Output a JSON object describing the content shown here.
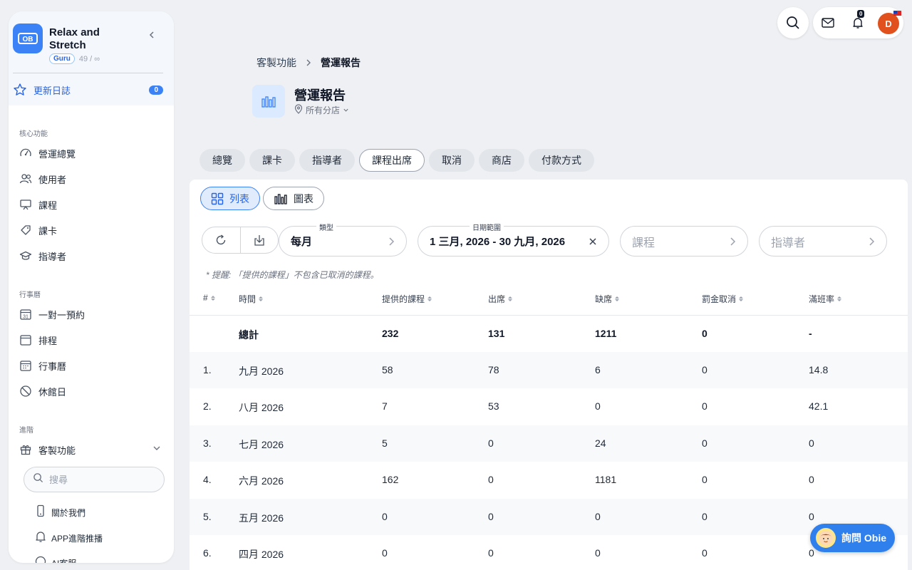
{
  "brand": {
    "name": "Relax and Stretch",
    "tier": "Guru",
    "count": "49 / ∞"
  },
  "changelog": {
    "label": "更新日誌",
    "count": "0"
  },
  "sidebar": {
    "core_label": "核心功能",
    "core": [
      "營運總覽",
      "使用者",
      "課程",
      "課卡",
      "指導者"
    ],
    "calendar_label": "行事曆",
    "calendar": [
      "一對一預約",
      "排程",
      "行事曆",
      "休館日"
    ],
    "advanced_label": "進階",
    "custom": "客製功能",
    "search_placeholder": "搜尋",
    "sub": [
      "關於我們",
      "APP進階推播",
      "AI客服"
    ]
  },
  "topbar": {
    "notifications": "0",
    "avatar_initial": "D"
  },
  "breadcrumb": {
    "parent": "客製功能",
    "current": "營運報告"
  },
  "page": {
    "title": "營運報告",
    "branch": "所有分店"
  },
  "tabs": [
    "總覽",
    "課卡",
    "指導者",
    "課程出席",
    "取消",
    "商店",
    "付款方式"
  ],
  "active_tab": "課程出席",
  "view": {
    "list": "列表",
    "chart": "圖表"
  },
  "filters": {
    "type_caption": "類型",
    "type_value": "每月",
    "date_caption": "日期範圍",
    "date_value": "1 三月, 2026 - 30 九月, 2026",
    "course_placeholder": "課程",
    "instructor_placeholder": "指導者"
  },
  "note": "* 提醒: 「提供的課程」不包含已取消的課程。",
  "table": {
    "headers": [
      "#",
      "時間",
      "提供的課程",
      "出席",
      "缺席",
      "罰金取消",
      "滿班率"
    ],
    "total": [
      "",
      "總計",
      "232",
      "131",
      "1211",
      "0",
      "-"
    ],
    "rows": [
      [
        "1.",
        "九月 2026",
        "58",
        "78",
        "6",
        "0",
        "14.8"
      ],
      [
        "2.",
        "八月 2026",
        "7",
        "53",
        "0",
        "0",
        "42.1"
      ],
      [
        "3.",
        "七月 2026",
        "5",
        "0",
        "24",
        "0",
        "0"
      ],
      [
        "4.",
        "六月 2026",
        "162",
        "0",
        "1181",
        "0",
        "0"
      ],
      [
        "5.",
        "五月 2026",
        "0",
        "0",
        "0",
        "0",
        "0"
      ],
      [
        "6.",
        "四月 2026",
        "0",
        "0",
        "0",
        "0",
        "0"
      ]
    ]
  },
  "assistant": {
    "label": "詢問 Obie"
  },
  "colors": {
    "accent": "#3b82f6",
    "avatar": "#e0511d",
    "assistant": "#2f80ed"
  }
}
